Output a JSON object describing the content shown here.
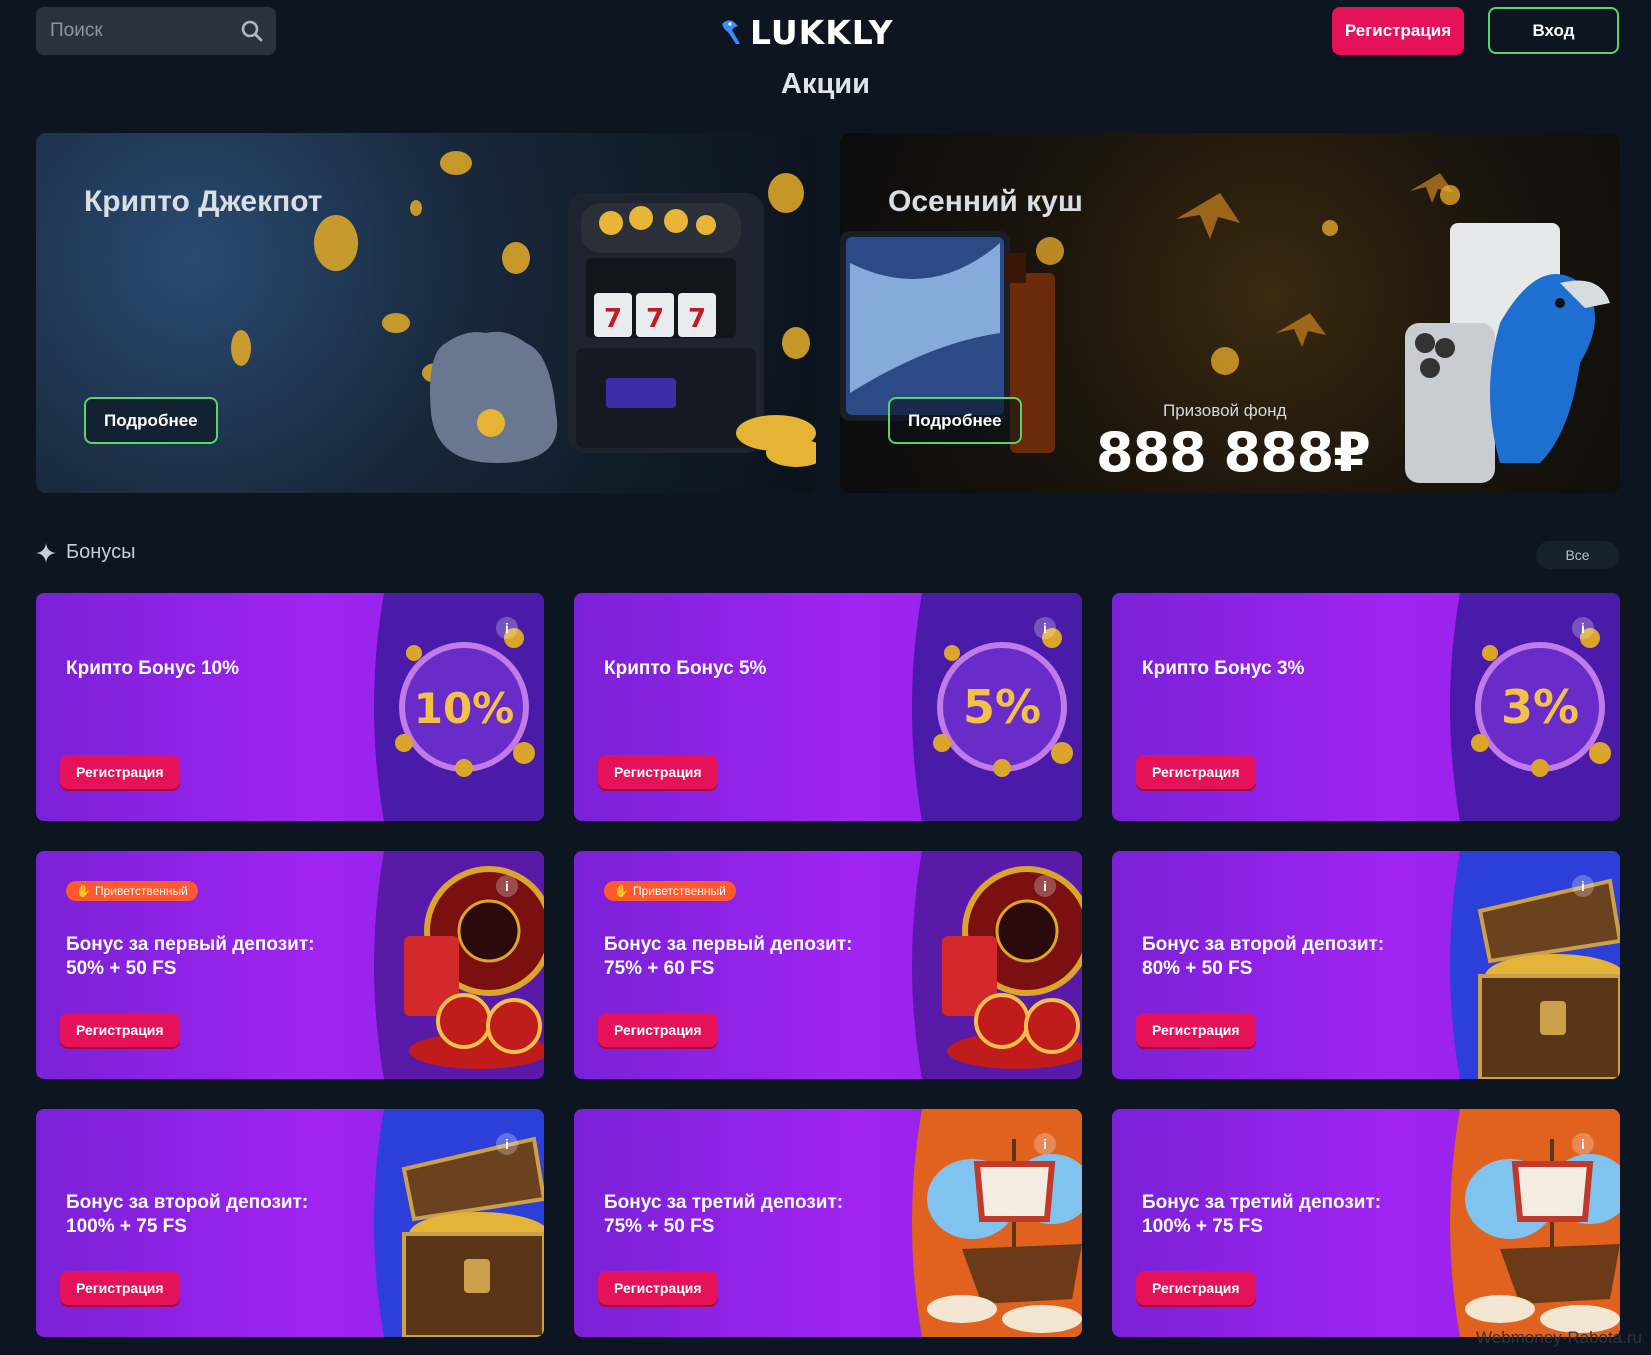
{
  "header": {
    "search_placeholder": "Поиск",
    "logo_text": "LUKKLY",
    "register_label": "Регистрация",
    "login_label": "Вход"
  },
  "page_title": "Акции",
  "promos": [
    {
      "title": "Крипто Джекпот",
      "button": "Подробнее"
    },
    {
      "title": "Осенний куш",
      "button": "Подробнее",
      "prize_label": "Призовой фонд",
      "prize_value": "888 888₽"
    }
  ],
  "bonuses": {
    "section_title": "Бонусы",
    "all_label": "Все",
    "cards": [
      {
        "title": "Крипто Бонус 10%",
        "art_text": "10%",
        "button": "Регистрация"
      },
      {
        "title": "Крипто Бонус 5%",
        "art_text": "5%",
        "button": "Регистрация"
      },
      {
        "title": "Крипто Бонус 3%",
        "art_text": "3%",
        "button": "Регистрация"
      },
      {
        "tag": "Приветственный",
        "title_line1": "Бонус за первый депозит:",
        "title_line2": "50% + 50 FS",
        "button": "Регистрация"
      },
      {
        "tag": "Приветственный",
        "title_line1": "Бонус за первый депозит:",
        "title_line2": "75% + 60 FS",
        "button": "Регистрация"
      },
      {
        "title_line1": "Бонус за второй депозит:",
        "title_line2": "80% + 50 FS",
        "button": "Регистрация"
      },
      {
        "title_line1": "Бонус за второй депозит:",
        "title_line2": "100% + 75 FS",
        "button": "Регистрация"
      },
      {
        "title_line1": "Бонус за третий депозит:",
        "title_line2": "75% + 50 FS",
        "button": "Регистрация"
      },
      {
        "title_line1": "Бонус за третий депозит:",
        "title_line2": "100% + 75 FS",
        "button": "Регистрация"
      }
    ],
    "info_label": "i"
  },
  "watermark": "Webmoney-Rabota.ru",
  "colors": {
    "background": "#0d1620",
    "accent_pink": "#e5125a",
    "accent_green": "#58d56a",
    "card_purple": "#a024f2",
    "tag_orange": "#ff5a2d"
  }
}
